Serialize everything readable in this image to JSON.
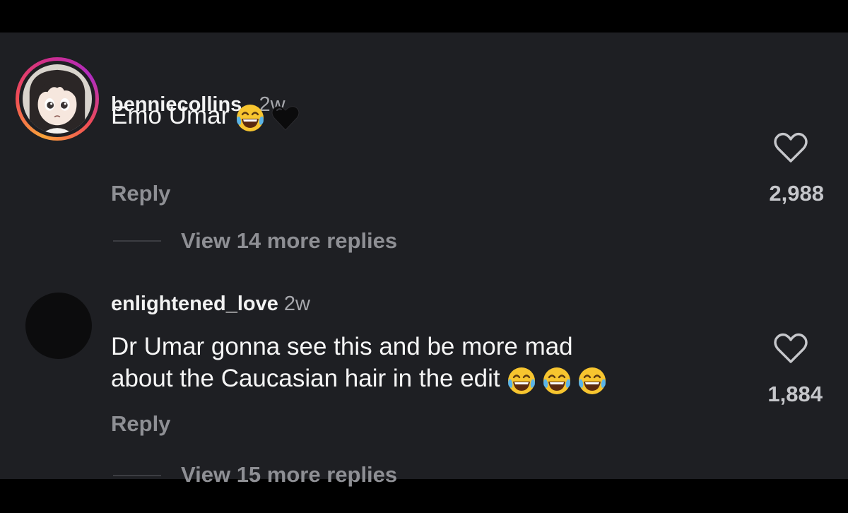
{
  "comments": [
    {
      "username": "benniecollins_",
      "time": "2w",
      "text": "Emo Umar",
      "emojis": [
        "face-with-tears-of-joy",
        "black-heart"
      ],
      "reply_label": "Reply",
      "likes": "2,988",
      "view_replies": "View 14 more replies",
      "avatar": "anime-girl-avatar-with-story-ring"
    },
    {
      "username": "enlightened_love",
      "time": "2w",
      "text_line1": "Dr Umar gonna see this and be more mad",
      "text_line2": "about the Caucasian hair in the edit",
      "emojis": [
        "face-with-tears-of-joy",
        "face-with-tears-of-joy",
        "face-with-tears-of-joy"
      ],
      "reply_label": "Reply",
      "likes": "1,884",
      "view_replies": "View 15 more replies",
      "avatar": "dark-avatar"
    }
  ],
  "icons": {
    "like": "heart-outline-icon"
  },
  "colors": {
    "background": "#1e1f23",
    "letterbox": "#000000",
    "text_primary": "#f5f5f5",
    "text_secondary": "#8e8f94",
    "story_ring": [
      "#f9a43a",
      "#f04c55",
      "#d02d8b",
      "#b02cc0"
    ]
  }
}
